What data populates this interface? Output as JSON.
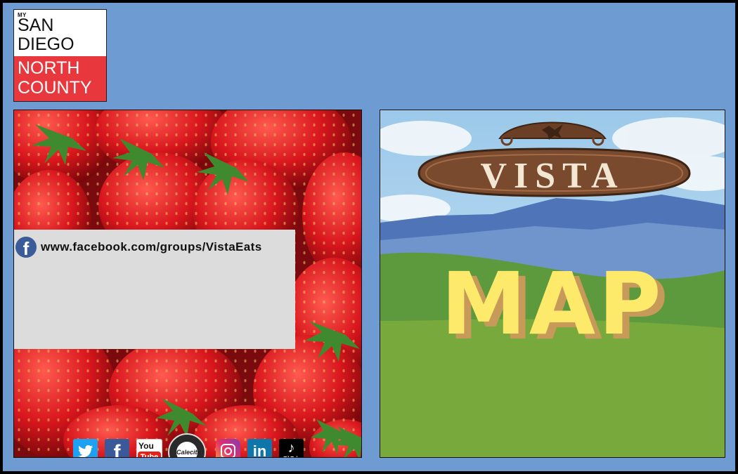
{
  "logo": {
    "my": "MY",
    "line1": "SAN",
    "line2": "DIEGO",
    "line3": "NORTH",
    "line4": "COUNTY"
  },
  "facebook": {
    "url": "www.facebook.com/groups/VistaEats",
    "icon": "facebook-icon"
  },
  "social_icons": [
    {
      "name": "twitter-icon",
      "color": "#1da1f2"
    },
    {
      "name": "facebook-icon",
      "color": "#3b5998"
    },
    {
      "name": "youtube-icon",
      "color": "#e62117",
      "label": "You Tube"
    },
    {
      "name": "calecita-icon",
      "color": "#2a2a2a",
      "label": "Calecita"
    },
    {
      "name": "instagram-icon",
      "color": "#c13584"
    },
    {
      "name": "linkedin-icon",
      "color": "#0e76a8",
      "label": "in"
    },
    {
      "name": "tiktok-icon",
      "color": "#000000",
      "label": "TikTok"
    }
  ],
  "vista": {
    "banner": "VISTA",
    "title": "MAP"
  },
  "colors": {
    "background": "#6f9bd3",
    "logo_red": "#e8383e",
    "banner_brown": "#7a4a2f",
    "map_yellow": "#fde96a",
    "grass": "#7aa540"
  }
}
